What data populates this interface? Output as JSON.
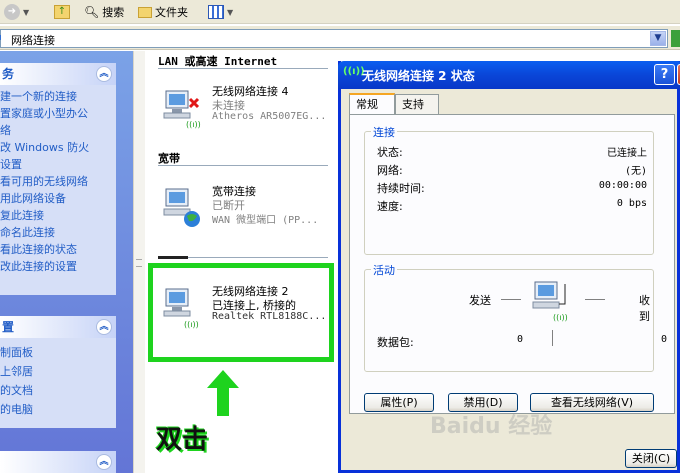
{
  "toolbar": {
    "search_label": "搜索",
    "folders_label": "文件夹"
  },
  "address": {
    "value": "网络连接"
  },
  "left_pane": {
    "tasks_header": "务",
    "tasks": [
      "建一个新的连接",
      "置家庭或小型办公",
      "络",
      "改 Windows 防火",
      "设置",
      "看可用的无线网络",
      "用此网络设备",
      "复此连接",
      "命名此连接",
      "看此连接的状态",
      "改此连接的设置"
    ],
    "places_header": "置",
    "places": [
      "制面板",
      "上邻居",
      "的文档",
      "的电脑"
    ],
    "details_header": ""
  },
  "main": {
    "group_lan": "LAN 或高速 Internet",
    "group_broadband": "宽带",
    "connections": [
      {
        "name": "无线网络连接 4",
        "status": "未连接",
        "device": "Atheros AR5007EG..."
      },
      {
        "name": "宽带连接",
        "status": "已断开",
        "device": "WAN 微型端口 (PP..."
      },
      {
        "name": "无线网络连接 2",
        "status": "已连接上, 桥接的",
        "device": "Realtek RTL8188C..."
      }
    ]
  },
  "annotation": {
    "double_click": "双击"
  },
  "dialog": {
    "title": "无线网络连接 2 状态",
    "tabs": [
      "常规",
      "支持"
    ],
    "connection_group": "连接",
    "rows": [
      {
        "k": "状态:",
        "v": "已连接上"
      },
      {
        "k": "网络:",
        "v": "(无)"
      },
      {
        "k": "持续时间:",
        "v": "00:00:00"
      },
      {
        "k": "速度:",
        "v": "0 bps"
      }
    ],
    "activity_group": "活动",
    "sent_label": "发送",
    "received_label": "收到",
    "packets_label": "数据包:",
    "packets_sent": "0",
    "packets_received": "0",
    "btn_properties": "属性(P)",
    "btn_disable": "禁用(D)",
    "btn_view_wireless": "查看无线网络(V)",
    "btn_close": "关闭(C)",
    "help_btn": "?",
    "close_btn": "X"
  },
  "watermark": "Baidu 经验",
  "colors": {
    "accent_green": "#1ed31e",
    "title_blue": "#0a46d8",
    "link_blue": "#215dc6"
  }
}
